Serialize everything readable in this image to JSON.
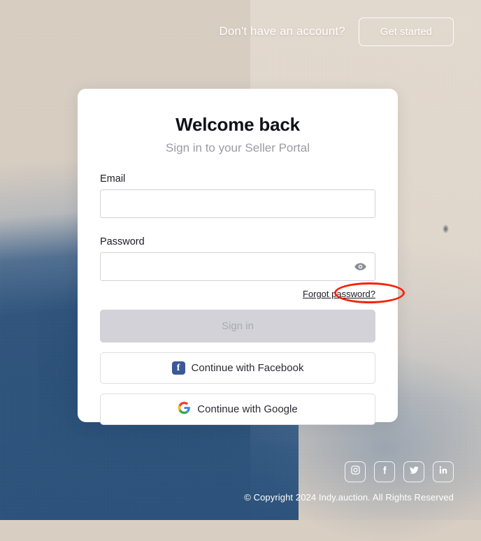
{
  "header": {
    "prompt_text": "Don't have an account?",
    "get_started_label": "Get started"
  },
  "card": {
    "title": "Welcome back",
    "subtitle": "Sign in to your Seller Portal",
    "email": {
      "label": "Email",
      "value": "",
      "placeholder": ""
    },
    "password": {
      "label": "Password",
      "value": "",
      "placeholder": "",
      "toggle_icon": "eye-icon"
    },
    "forgot_password_label": "Forgot password?",
    "signin_label": "Sign in",
    "facebook_label": "Continue with Facebook",
    "google_label": "Continue with Google"
  },
  "footer": {
    "social": [
      {
        "name": "instagram",
        "label": "Instagram"
      },
      {
        "name": "facebook",
        "label": "Facebook"
      },
      {
        "name": "twitter",
        "label": "Twitter"
      },
      {
        "name": "linkedin",
        "label": "LinkedIn"
      }
    ],
    "copyright": "© Copyright 2024 Indy.auction. All Rights Reserved"
  },
  "colors": {
    "annotation_red": "#fb2008",
    "facebook_blue": "#3b5998",
    "google_blue": "#4285f4",
    "google_red": "#ea4335",
    "google_yellow": "#fbbc05",
    "google_green": "#34a853",
    "disabled_button_bg": "#d2d2d8",
    "disabled_button_text": "#a9a9b2",
    "background_top": "#e4dbd0",
    "background_bottom": "#2c527e"
  }
}
